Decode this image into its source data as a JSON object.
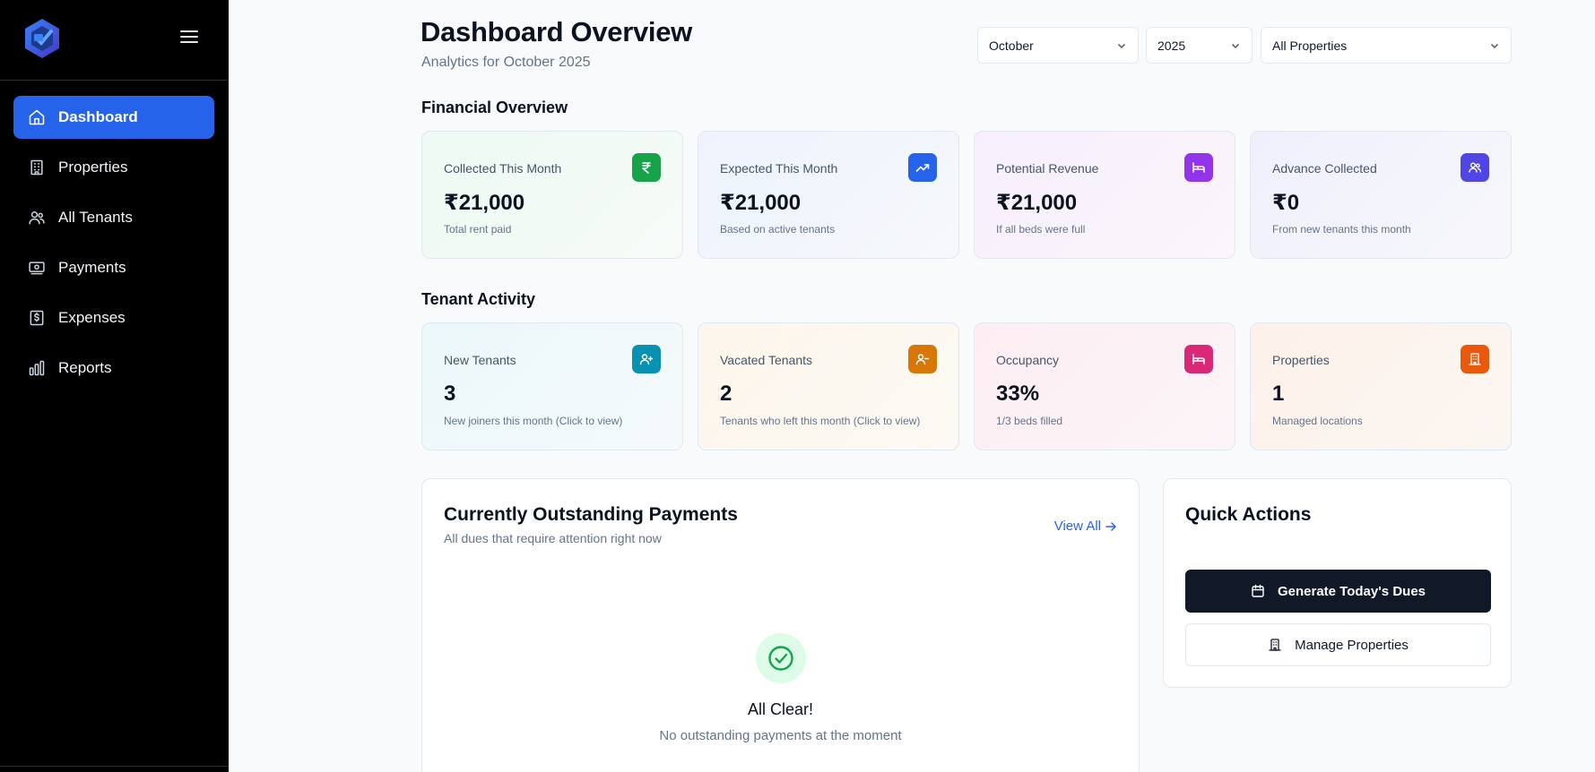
{
  "sidebar": {
    "items": [
      {
        "label": "Dashboard",
        "icon": "home-icon",
        "active": true
      },
      {
        "label": "Properties",
        "icon": "building-icon"
      },
      {
        "label": "All Tenants",
        "icon": "users-icon"
      },
      {
        "label": "Payments",
        "icon": "banknote-icon"
      },
      {
        "label": "Expenses",
        "icon": "receipt-icon"
      },
      {
        "label": "Reports",
        "icon": "bar-chart-icon"
      }
    ]
  },
  "header": {
    "title": "Dashboard Overview",
    "subtitle": "Analytics for October 2025"
  },
  "filters": {
    "month": "October",
    "year": "2025",
    "property": "All Properties"
  },
  "financial": {
    "section_title": "Financial Overview",
    "cards": [
      {
        "label": "Collected This Month",
        "value": "₹21,000",
        "sub": "Total rent paid",
        "icon": "rupee-icon",
        "color": "#16a34a"
      },
      {
        "label": "Expected This Month",
        "value": "₹21,000",
        "sub": "Based on active tenants",
        "icon": "trending-up-icon",
        "color": "#2563eb"
      },
      {
        "label": "Potential Revenue",
        "value": "₹21,000",
        "sub": "If all beds were full",
        "icon": "bed-icon",
        "color": "#9333ea"
      },
      {
        "label": "Advance Collected",
        "value": "₹0",
        "sub": "From new tenants this month",
        "icon": "users-icon",
        "color": "#4f46e5"
      }
    ]
  },
  "tenant_activity": {
    "section_title": "Tenant Activity",
    "cards": [
      {
        "label": "New Tenants",
        "value": "3",
        "sub": "New joiners this month (Click to view)",
        "icon": "user-plus-icon",
        "color": "#0891b2"
      },
      {
        "label": "Vacated Tenants",
        "value": "2",
        "sub": "Tenants who left this month (Click to view)",
        "icon": "user-minus-icon",
        "color": "#d97706"
      },
      {
        "label": "Occupancy",
        "value": "33%",
        "sub": "1/3 beds filled",
        "icon": "bed-icon",
        "color": "#db2777"
      },
      {
        "label": "Properties",
        "value": "1",
        "sub": "Managed locations",
        "icon": "building-icon",
        "color": "#ea580c"
      }
    ]
  },
  "outstanding": {
    "title": "Currently Outstanding Payments",
    "subtitle": "All dues that require attention right now",
    "view_all": "View All",
    "empty_title": "All Clear!",
    "empty_sub": "No outstanding payments at the moment"
  },
  "quick_actions": {
    "title": "Quick Actions",
    "primary": "Generate Today's Dues",
    "secondary": "Manage Properties"
  }
}
